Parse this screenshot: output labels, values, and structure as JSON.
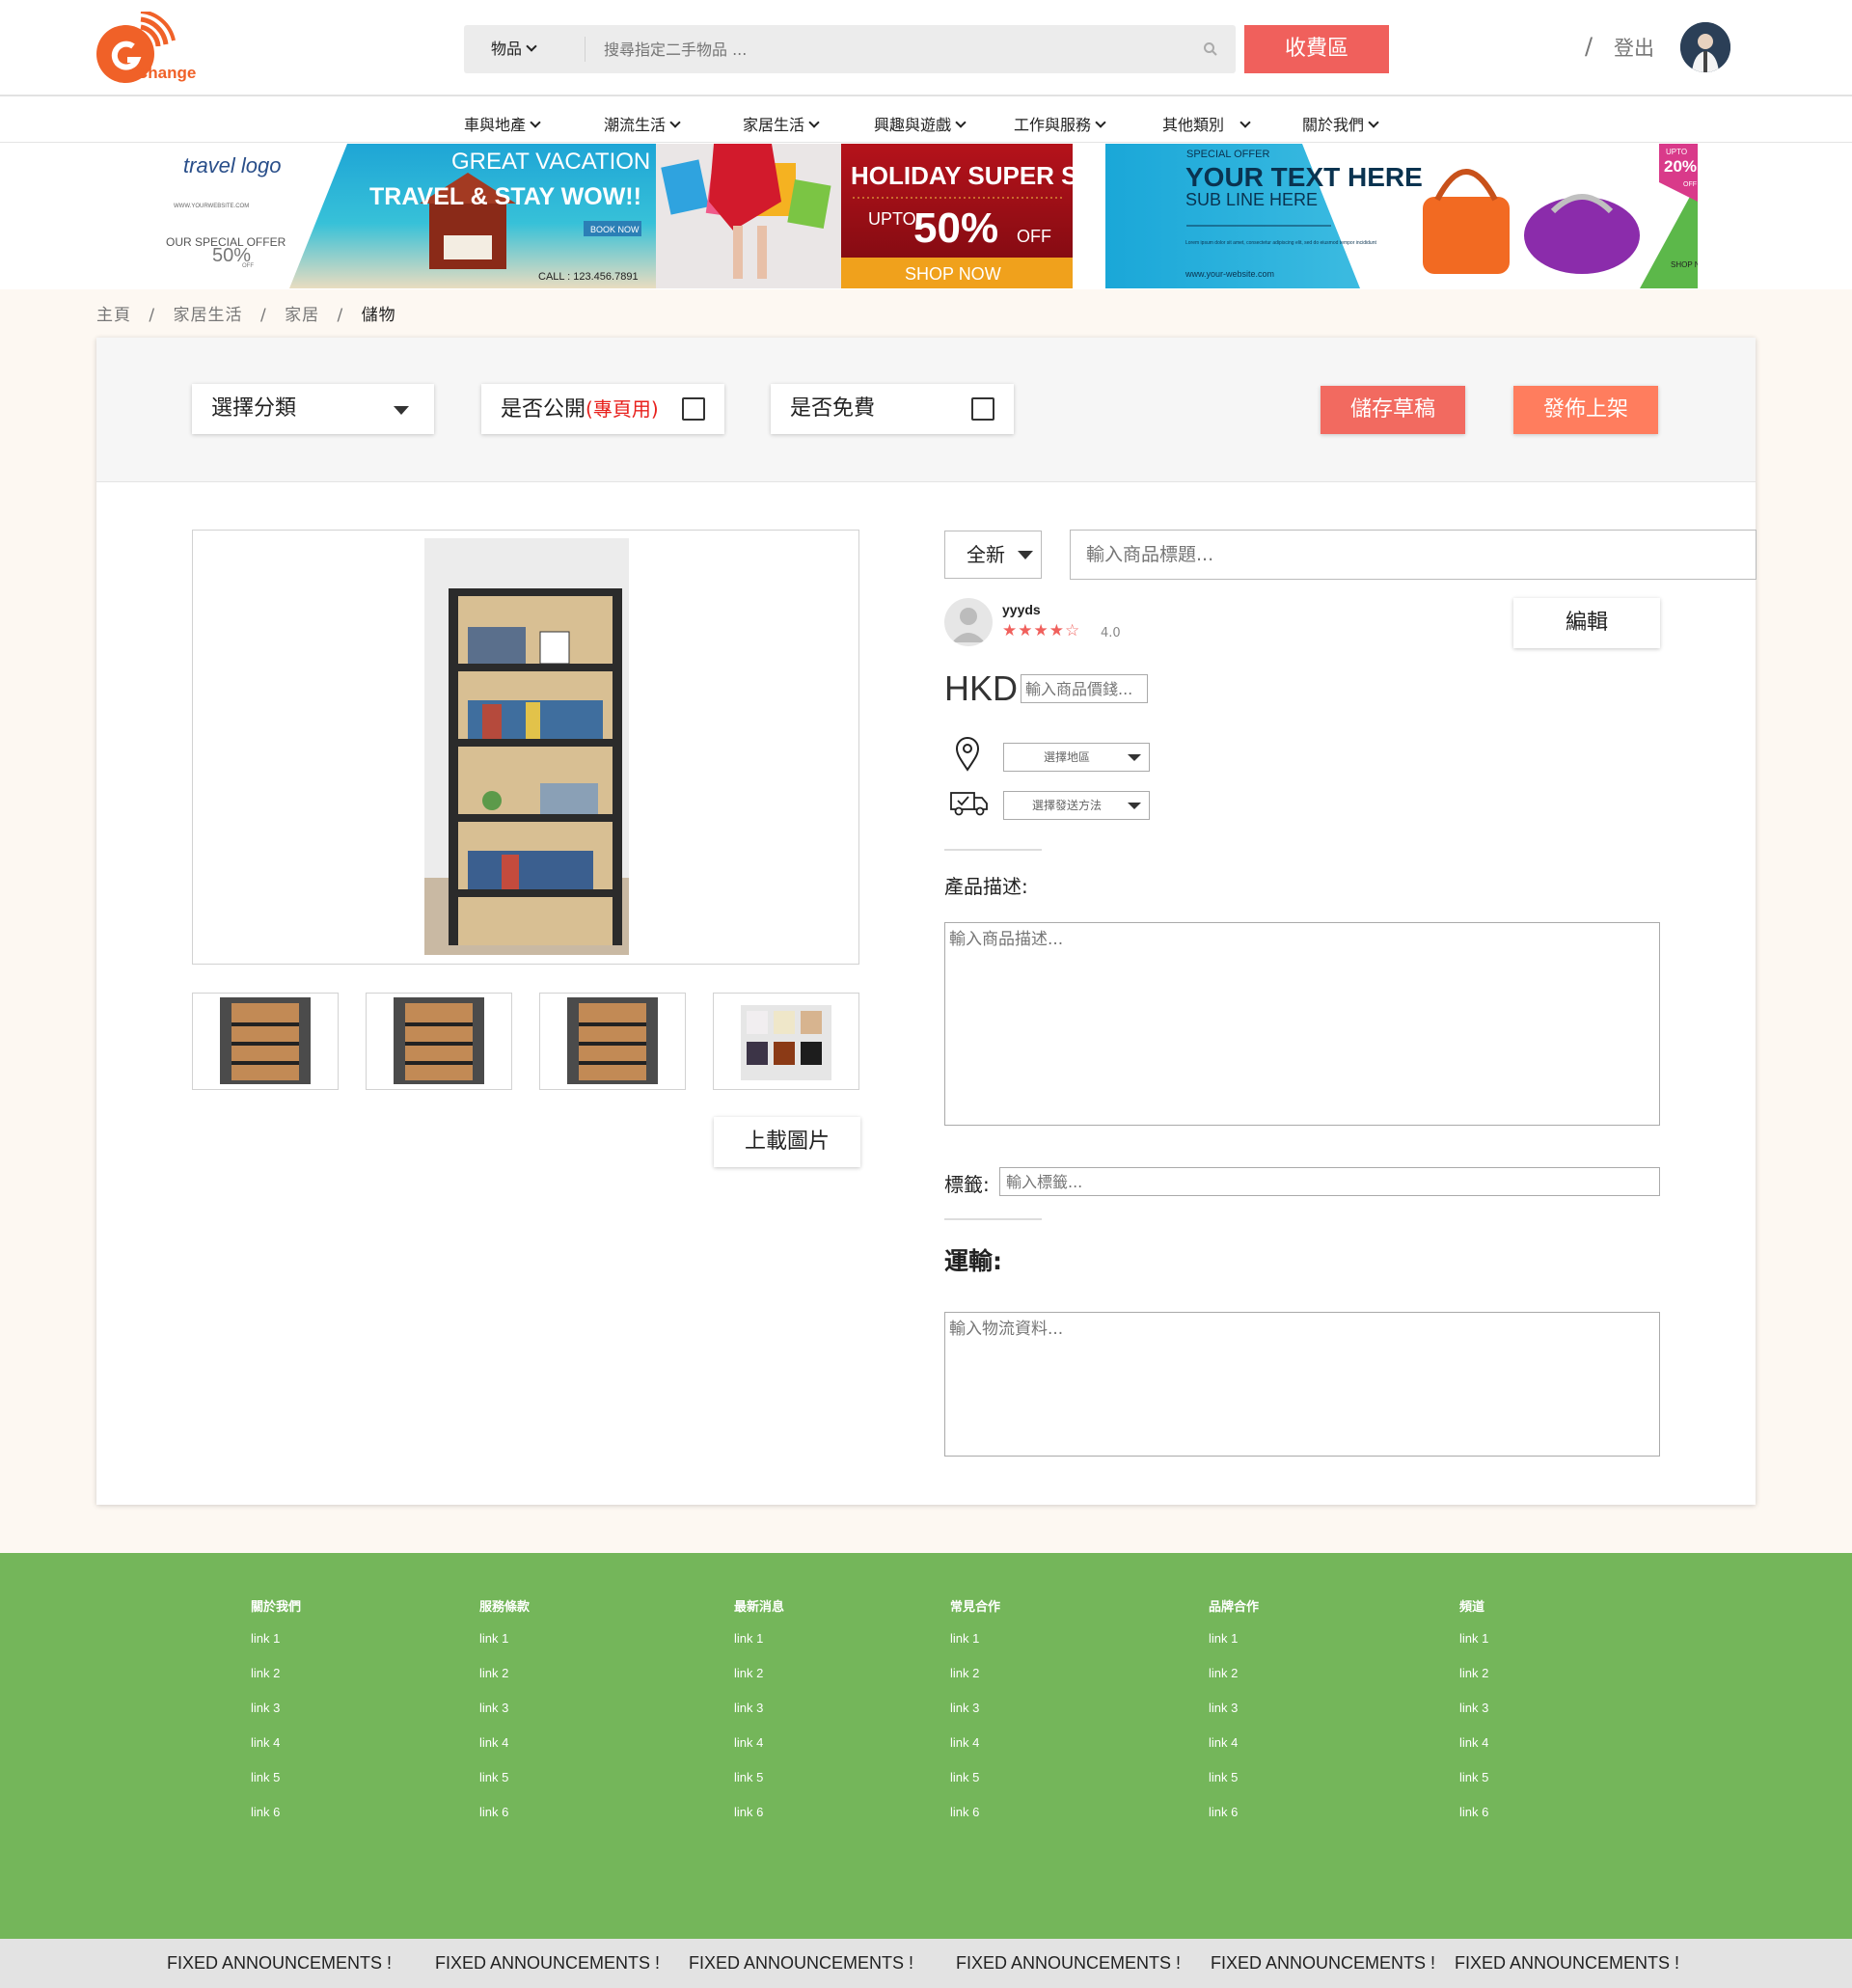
{
  "header": {
    "logo_text": "Change",
    "search": {
      "category": "物品",
      "placeholder": "搜尋指定二手物品 ..."
    },
    "fee_button": "收費區",
    "slash": "/",
    "logout": "登出"
  },
  "nav": {
    "items": [
      {
        "label": "車與地產"
      },
      {
        "label": "潮流生活"
      },
      {
        "label": "家居生活"
      },
      {
        "label": "興趣與遊戲"
      },
      {
        "label": "工作與服務"
      },
      {
        "label": "其他類別"
      },
      {
        "label": "關於我們"
      }
    ]
  },
  "banner": {
    "a": {
      "logo": "travel logo",
      "site": "WWW.YOURWEBSITE.COM",
      "offer": "OUR SPECIAL OFFER",
      "percent": "50%",
      "off": "OFF",
      "headline1": "GREAT VACATION",
      "headline2": "TRAVEL & STAY WOW!!",
      "book": "BOOK NOW",
      "call": "CALL : 123.456.7891"
    },
    "b": {
      "headline": "HOLIDAY SUPER SALE",
      "upto": "UPTO",
      "percent": "50%",
      "off": "OFF",
      "shop": "SHOP NOW"
    },
    "c": {
      "special": "SPECIAL OFFER",
      "title": "YOUR TEXT HERE",
      "subline": "SUB LINE HERE",
      "body": "Lorem ipsum dolor sit amet, consectetur adipiscing elit, sed do eiusmod tempor incididunt",
      "site": "www.your-website.com",
      "upto": "UPTO",
      "percent": "20%",
      "off": "OFF",
      "shop": "SHOP NOW!"
    }
  },
  "breadcrumb": {
    "home": "主頁",
    "l1": "家居生活",
    "l2": "家居",
    "current": "儲物",
    "sep": "/"
  },
  "toolbar": {
    "category_select": "選擇分類",
    "public_label": "是否公開",
    "public_note": "(專頁用)",
    "free_label": "是否免費",
    "save_draft": "儲存草稿",
    "publish": "發佈上架"
  },
  "product": {
    "condition": "全新",
    "title_placeholder": "輸入商品標題...",
    "seller": {
      "name": "yyyds",
      "stars": "★★★★☆",
      "rating": "4.0",
      "rating_value": 4.0
    },
    "edit_button": "編輯",
    "currency": "HKD",
    "price_placeholder": "輸入商品價錢...",
    "region_select": "選擇地區",
    "delivery_select": "選擇發送方法",
    "description_label": "產品描述:",
    "description_placeholder": "輸入商品描述...",
    "tags_label": "標籤:",
    "tags_placeholder": "輸入標籤...",
    "shipping_label": "運輸:",
    "shipping_placeholder": "輸入物流資料...",
    "upload_button": "上載圖片"
  },
  "colors": {
    "accent": "#f0605c",
    "orange": "#ff7d5e",
    "footer": "#74b65a",
    "logo": "#f06128"
  },
  "footer": {
    "columns": [
      {
        "title": "關於我們",
        "links": [
          "link 1",
          "link 2",
          "link 3",
          "link 4",
          "link 5",
          "link 6"
        ]
      },
      {
        "title": "服務條款",
        "links": [
          "link 1",
          "link 2",
          "link 3",
          "link 4",
          "link 5",
          "link 6"
        ]
      },
      {
        "title": "最新消息",
        "links": [
          "link 1",
          "link 2",
          "link 3",
          "link 4",
          "link 5",
          "link 6"
        ]
      },
      {
        "title": "常見合作",
        "links": [
          "link 1",
          "link 2",
          "link 3",
          "link 4",
          "link 5",
          "link 6"
        ]
      },
      {
        "title": "品牌合作",
        "links": [
          "link 1",
          "link 2",
          "link 3",
          "link 4",
          "link 5",
          "link 6"
        ]
      },
      {
        "title": "頻道",
        "links": [
          "link 1",
          "link 2",
          "link 3",
          "link 4",
          "link 5",
          "link 6"
        ]
      }
    ],
    "announcements": [
      "FIXED ANNOUNCEMENTS !",
      "FIXED ANNOUNCEMENTS !",
      "FIXED ANNOUNCEMENTS !",
      "FIXED ANNOUNCEMENTS !",
      "FIXED ANNOUNCEMENTS !",
      "FIXED ANNOUNCEMENTS !"
    ]
  }
}
